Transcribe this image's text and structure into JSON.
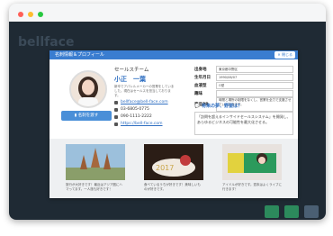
{
  "window": {
    "traffic_lights": [
      "#ff5f57",
      "#febc2e",
      "#28c840"
    ],
    "logo": "bellface"
  },
  "modal": {
    "title": "名刺情報＆プロフィール",
    "close_label": "閉じる"
  },
  "profile": {
    "company": "セールスチーム",
    "name": "小正　一葉",
    "bio": "新卒でアパレルメーカーの営業をしていました。現在はセールスを担当しております。",
    "card_button": "名刺を渡す",
    "email": "bellface@bell-face.com",
    "phone": "03-6805-0775",
    "mobile": "090-1111-2222",
    "url": "https://bell-face.com"
  },
  "details": {
    "rows": [
      {
        "key": "出身地",
        "value": "東京都中野区"
      },
      {
        "key": "生年月日",
        "value": "1990/06/07"
      },
      {
        "key": "血液型",
        "value": "O型"
      },
      {
        "key": "趣味",
        "value": ""
      },
      {
        "key": "商品PR",
        "value": "時間と場所の制限をなくし、営業を全力で支援させていただきます。"
      }
    ],
    "dream_title": "将来の夢、野望は？",
    "dream_text": "「訪問を超えるインサイドセールスシステム」を開発し、あらゆるビジネスの可能性を最大化させる。"
  },
  "gallery": [
    {
      "caption": "旅行が大好きです！最近はアジア圏にハマってます。一人旅も好きです！"
    },
    {
      "caption": "食べているうちが好きです！美味しいものが好きです。"
    },
    {
      "caption": "アイドルが好きです。週末はよくライブに行きます！"
    }
  ],
  "colors": {
    "header": "#3a7dd0",
    "link": "#2f6fc2",
    "app_bg": "#1f2a34"
  }
}
